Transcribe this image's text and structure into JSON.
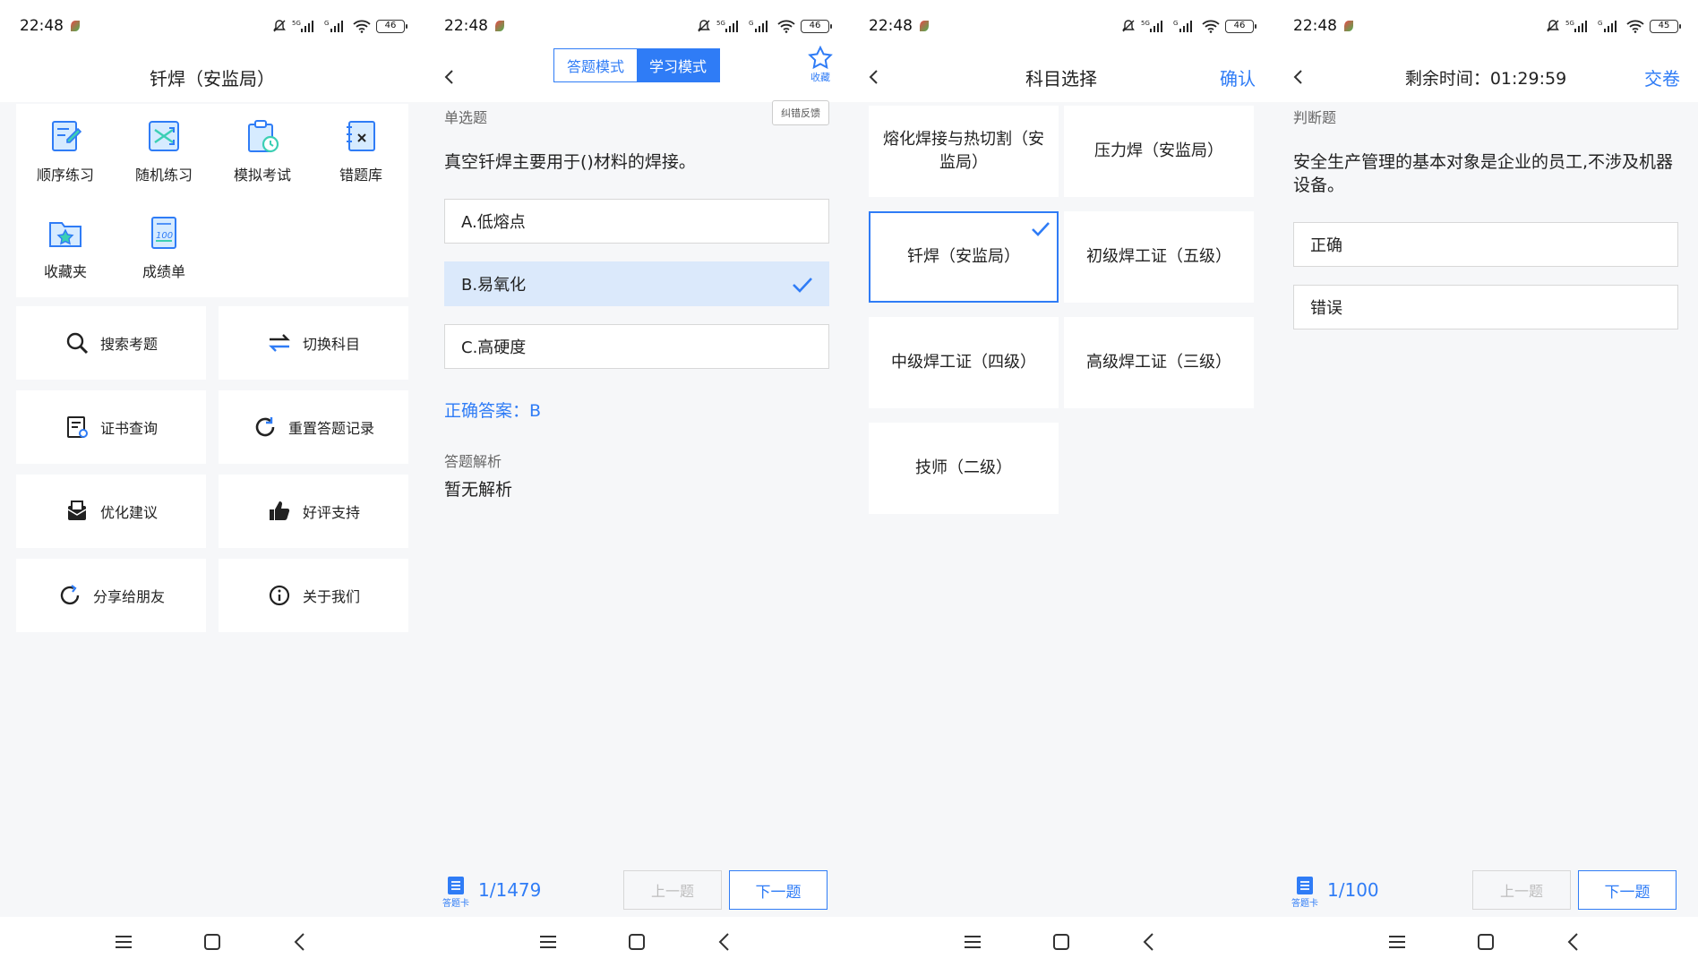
{
  "status_bar": {
    "time": "22:48",
    "battery_screens": [
      "46",
      "46",
      "46",
      "45"
    ]
  },
  "colors": {
    "accent": "#2f7cf6",
    "selected_bg": "#dbe9fb"
  },
  "home": {
    "title": "钎焊（安监局）",
    "grid": [
      {
        "label": "顺序练习",
        "icon": "pencil-notebook-icon"
      },
      {
        "label": "随机练习",
        "icon": "shuffle-icon"
      },
      {
        "label": "模拟考试",
        "icon": "clipboard-clock-icon"
      },
      {
        "label": "错题库",
        "icon": "wrong-book-icon"
      },
      {
        "label": "收藏夹",
        "icon": "star-folder-icon"
      },
      {
        "label": "成绩单",
        "icon": "score-sheet-icon"
      }
    ],
    "menu": [
      {
        "label": "搜索考题",
        "icon": "search-icon"
      },
      {
        "label": "切换科目",
        "icon": "swap-icon"
      },
      {
        "label": "证书查询",
        "icon": "certificate-icon"
      },
      {
        "label": "重置答题记录",
        "icon": "reset-icon"
      },
      {
        "label": "优化建议",
        "icon": "mailbox-icon"
      },
      {
        "label": "好评支持",
        "icon": "thumbs-up-icon"
      },
      {
        "label": "分享给朋友",
        "icon": "share-icon"
      },
      {
        "label": "关于我们",
        "icon": "info-icon"
      }
    ]
  },
  "study": {
    "mode_answer": "答题模式",
    "mode_study": "学习模式",
    "favorite_label": "收藏",
    "question_type": "单选题",
    "feedback_label": "纠错反馈",
    "question": "真空钎焊主要用于()材料的焊接。",
    "options": [
      "A.低熔点",
      "B.易氧化",
      "C.高硬度"
    ],
    "selected_index": 1,
    "correct_answer": "正确答案：B",
    "analysis_title": "答题解析",
    "analysis_text": "暂无解析",
    "card_label": "答题卡",
    "progress": "1/1479",
    "prev_label": "上一题",
    "next_label": "下一题"
  },
  "subject_select": {
    "title": "科目选择",
    "confirm": "确认",
    "subjects": [
      "熔化焊接与热切割（安监局）",
      "压力焊（安监局）",
      "钎焊（安监局）",
      "初级焊工证（五级）",
      "中级焊工证（四级）",
      "高级焊工证（三级）",
      "技师（二级）"
    ],
    "selected_index": 2
  },
  "exam": {
    "timer_label": "剩余时间：01:29:59",
    "submit": "交卷",
    "question_type": "判断题",
    "question": "安全生产管理的基本对象是企业的员工,不涉及机器设备。",
    "options": [
      "正确",
      "错误"
    ],
    "card_label": "答题卡",
    "progress": "1/100",
    "prev_label": "上一题",
    "next_label": "下一题"
  }
}
